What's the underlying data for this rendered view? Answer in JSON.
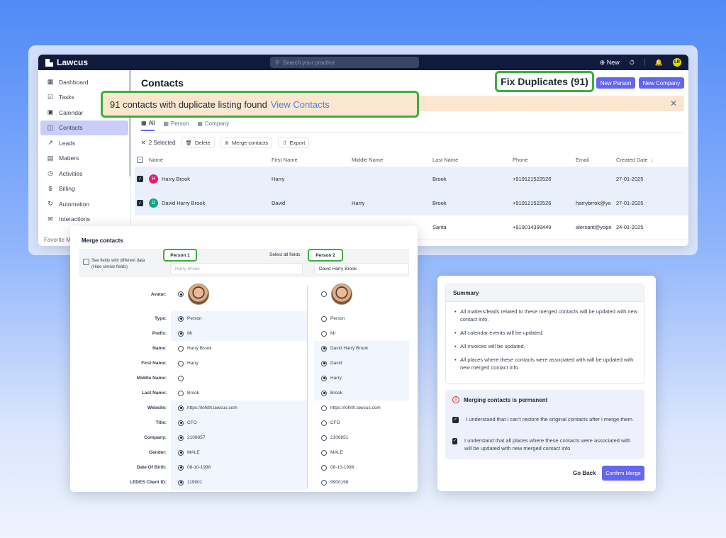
{
  "topbar": {
    "brand": "Lawcus",
    "search_placeholder": "Search your practice",
    "new_label": "New",
    "user_initials": "LR"
  },
  "sidebar": {
    "items": [
      {
        "label": "Dashboard",
        "icon": "dashboard-icon"
      },
      {
        "label": "Tasks",
        "icon": "tasks-icon"
      },
      {
        "label": "Calendar",
        "icon": "calendar-icon"
      },
      {
        "label": "Contacts",
        "icon": "contacts-icon",
        "active": true
      },
      {
        "label": "Leads",
        "icon": "leads-icon"
      },
      {
        "label": "Matters",
        "icon": "matters-icon"
      },
      {
        "label": "Activities",
        "icon": "activities-icon"
      },
      {
        "label": "Billing",
        "icon": "billing-icon"
      },
      {
        "label": "Automation",
        "icon": "automation-icon"
      },
      {
        "label": "Interactions",
        "icon": "interactions-icon"
      }
    ],
    "favorites": "Favorite M"
  },
  "header": {
    "title": "Contacts",
    "fix_duplicates": "Fix Duplicates (91)",
    "new_person": "New Person",
    "new_company": "New Company"
  },
  "banner": {
    "text": "91 contacts with duplicate listing found",
    "link": "View Contacts"
  },
  "tabs": [
    "All",
    "Person",
    "Company"
  ],
  "toolbar": {
    "selected": "2 Selected",
    "delete": "Delete",
    "merge": "Merge contacts",
    "export": "Export"
  },
  "table": {
    "headers": [
      "Name",
      "First Name",
      "Middle Name",
      "Last Name",
      "Phone",
      "Email",
      "Created Date"
    ],
    "rows": [
      {
        "initial": "H",
        "name": "Harry Brook",
        "first": "Harry",
        "middle": "",
        "last": "Brook",
        "phone": "+919121522526",
        "email": "",
        "created": "27-01-2025",
        "selected": true,
        "color": "#e11d6a"
      },
      {
        "initial": "D",
        "name": "David Harry Brook",
        "first": "David",
        "middle": "Harry",
        "last": "Brook",
        "phone": "+919121522526",
        "email": "harrybrrok@yo",
        "created": "27-01-2025",
        "selected": true,
        "color": "#14a38b"
      },
      {
        "initial": "",
        "name": "",
        "first": "",
        "middle": "",
        "last": "Santa",
        "phone": "+919014399449",
        "email": "alersant@yopn",
        "created": "24-01-2025",
        "selected": false,
        "color": "#ffffff"
      }
    ]
  },
  "merge": {
    "title": "Merge contacts",
    "diff_option_line1": "See fields with different data",
    "diff_option_line2": "(Hide similar fields)",
    "person1_label": "Person 1",
    "person2_label": "Person 2",
    "select_all": "Select all fields",
    "person1_name": "Harry Brook",
    "person2_name": "David Harry Brook",
    "rows": [
      {
        "label": "Type:",
        "v1": "Person",
        "v2": "Person",
        "sel": 1
      },
      {
        "label": "Prefix:",
        "v1": "Mr",
        "v2": "Mr",
        "sel": 1
      },
      {
        "label": "Name:",
        "v1": "Harry Brook",
        "v2": "David Harry Brook",
        "sel": 2
      },
      {
        "label": "First Name:",
        "v1": "Harry",
        "v2": "David",
        "sel": 2
      },
      {
        "label": "Middle Name:",
        "v1": "",
        "v2": "Harry",
        "sel": 2
      },
      {
        "label": "Last Name:",
        "v1": "Brook",
        "v2": "Brook",
        "sel": 2
      },
      {
        "label": "Website:",
        "v1": "https://lohith.lawcus.com",
        "v2": "https://lohith.lawcus.com",
        "sel": 1
      },
      {
        "label": "Title:",
        "v1": "CFO",
        "v2": "CFO",
        "sel": 1
      },
      {
        "label": "Company:",
        "v1": "2106857",
        "v2": "2106851",
        "sel": 1
      },
      {
        "label": "Gender:",
        "v1": "MALE",
        "v2": "MALE",
        "sel": 1
      },
      {
        "label": "Date Of Birth:",
        "v1": "08-10-1998",
        "v2": "08-10-1998",
        "sel": 1
      },
      {
        "label": "LEDES Client ID:",
        "v1": "119901",
        "v2": "9900198",
        "sel": 1
      }
    ],
    "avatar_label": "Avatar:"
  },
  "summary": {
    "title": "Summary",
    "items": [
      "All matters/leads related to these merged contacts will be updated with new contact info.",
      "All calendar events will be updated.",
      "All invoices will be updated.",
      "All places where these contacts were associated with will be updated with new merged contact info."
    ],
    "permanent_title": "Merging contacts is permanent",
    "ack1": "I understand that i can't restore the original contacts after i merge them.",
    "ack2": "I understand that all places where these contacts were associated with will be updated with new merged contact info",
    "go_back": "Go Back",
    "confirm": "Confirm Merge"
  }
}
